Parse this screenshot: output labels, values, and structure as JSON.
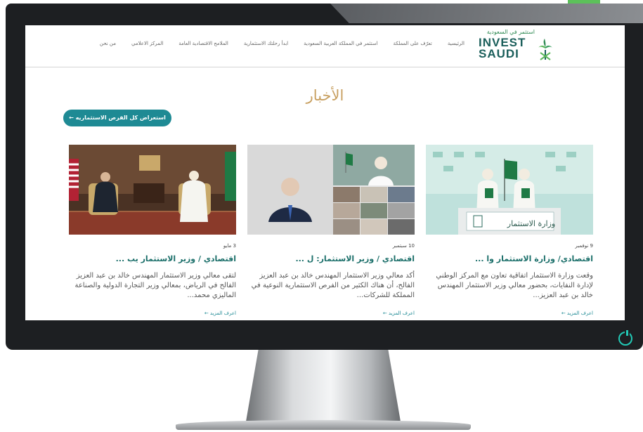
{
  "header": {
    "logo_top": "استثمر في السعودية",
    "logo_main": "INVEST SAUDI",
    "nav": [
      "الرئيسية",
      "تعرّف على المملكة",
      "استثمر في المملكة العربية السعودية",
      "ابدأ رحلتك الاستثمارية",
      "الملامح الاقتصادية العامة",
      "المركز الاعلامي",
      "من نحن"
    ]
  },
  "news": {
    "title": "الأخبار",
    "cta_label": "استعراض كل الفرص الاستثماريه ←"
  },
  "cards": [
    {
      "date": "9 نوفمبر",
      "title": "اقتصادي/ وزارة الاستثمار وا ...",
      "body": "وقعت وزارة الاستثمار اتفاقية تعاون مع المركز الوطني لإدارة النفايات، بحضور معالي وزير الاستثمار المهندس خالد بن عبد العزيز...",
      "more": "اعرف المزيد ←",
      "image_caption": "وزارة الاستثمار"
    },
    {
      "date": "10 سبتمبر",
      "title": "اقتصادي / وزير الاستثمار: ل ...",
      "body": "أكد معالي وزير الاستثمار المهندس خالد بن عبد العزيز الفالح، أن هناك الكثير من الفرص الاستثمارية النوعية في المملكة للشركات...",
      "more": "اعرف المزيد ←"
    },
    {
      "date": "3 مايو",
      "title": "اقتصادي / وزير الاستثمار يب ...",
      "body": "لتقى معالي وزير الاستثمار المهندس خالد بن عبد العزيز الفالح في الرياض، بمعالي وزير التجارة الدولية والصناعة الماليزي محمد...",
      "more": "اعرف المزيد ←"
    }
  ],
  "colors": {
    "accent_gold": "#c8a061",
    "teal": "#1e8a94",
    "title_green": "#1b6f6a",
    "bezel": "#1d1f22"
  }
}
